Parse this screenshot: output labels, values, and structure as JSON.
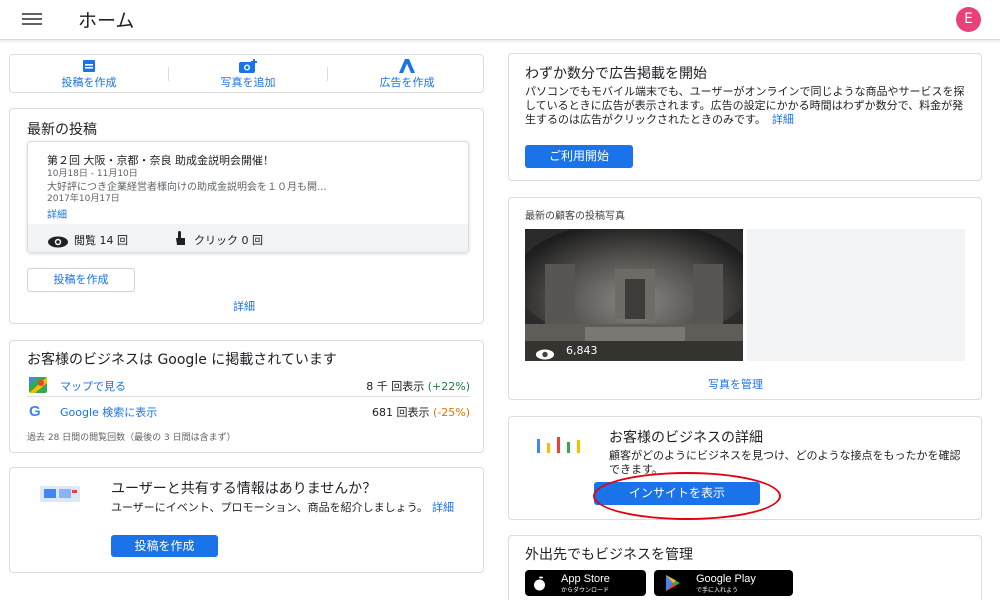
{
  "header": {
    "title": "ホーム",
    "avatar_letter": "E"
  },
  "actions": [
    {
      "label": "投稿を作成",
      "icon": "post-icon"
    },
    {
      "label": "写真を追加",
      "icon": "camera-icon"
    },
    {
      "label": "広告を作成",
      "icon": "ads-icon"
    }
  ],
  "latest_post": {
    "heading": "最新の投稿",
    "post_title": "第２回 大阪・京都・奈良 助成金説明会開催！",
    "date_range": "10月18日 - 11月10日",
    "snippet": "大好評につき企業経営者様向けの助成金説明会を１０月も開...",
    "posted_date": "2017年10月17日",
    "details_link": "詳細",
    "views": "閲覧 14 回",
    "clicks": "クリック 0 回",
    "create_button": "投稿を作成",
    "more_link": "詳細"
  },
  "listing": {
    "heading": "お客様のビジネスは Google に掲載されています",
    "rows": [
      {
        "label": "マップで見る",
        "value": "8 千 回表示",
        "change": "(+22%)",
        "change_color": "#188038",
        "icon": "maps-icon"
      },
      {
        "label": "Google 検索に表示",
        "value": "681 回表示",
        "change": "(-25%)",
        "change_color": "#e37400",
        "icon": "google-icon"
      }
    ],
    "note": "過去 28 日間の閲覧回数（最後の 3 日間は含まず）"
  },
  "share": {
    "heading": "ユーザーと共有する情報はありませんか？",
    "body": "ユーザーにイベント、プロモーション、商品を紹介しましょう。",
    "link": "詳細",
    "button": "投稿を作成"
  },
  "ads": {
    "heading": "わずか数分で広告掲載を開始",
    "body": "パソコンでもモバイル端末でも、ユーザーがオンラインで同じような商品やサービスを探しているときに広告が表示されます。広告の設定にかかる時間はわずか数分で、料金が発生するのは広告がクリックされたときのみです。",
    "link": "詳細",
    "button": "ご利用開始"
  },
  "photos": {
    "heading": "最新の顧客の投稿写真",
    "views": "6,843",
    "manage_link": "写真を管理"
  },
  "insights": {
    "heading": "お客様のビジネスの詳細",
    "body": "顧客がどのようにビジネスを見つけ、どのような接点をもったかを確認できます。",
    "button": "インサイトを表示"
  },
  "mobile": {
    "heading": "外出先でもビジネスを管理",
    "appstore_main": "App Store",
    "appstore_sub": "からダウンロード",
    "googleplay_main": "Google Play",
    "googleplay_sub": "で手に入れよう"
  },
  "colors": {
    "accent": "#1a73e8",
    "avatar": "#e9407a",
    "highlight_ring": "#e3000f"
  }
}
